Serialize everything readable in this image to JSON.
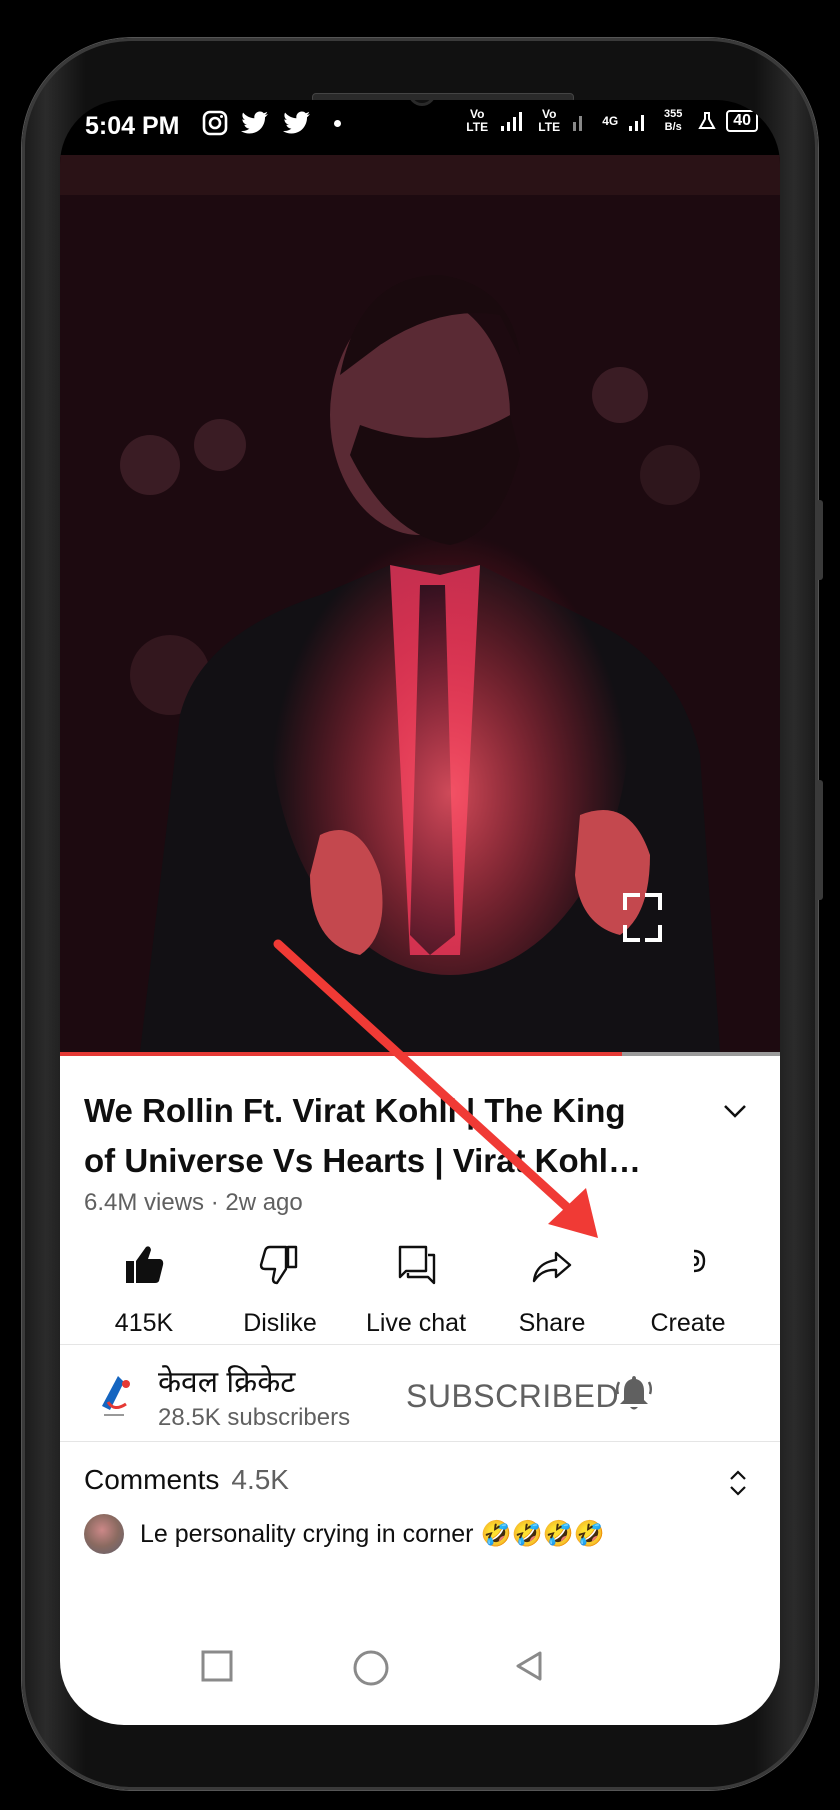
{
  "status_bar": {
    "time": "5:04 PM",
    "network_label_1": "Vo LTE",
    "network_label_2": "Vo LTE",
    "network_4g": "4G",
    "speed": "355 B/s",
    "battery": "40"
  },
  "video": {
    "fullscreen_icon": "fullscreen-icon",
    "progress": 0.78
  },
  "details": {
    "title_line1": "We Rollin Ft. Virat Kohli | The King",
    "title_line2": "of Universe Vs Hearts | Virat Kohli ...",
    "meta": "6.4M views · 2w ago"
  },
  "actions": [
    {
      "label": "415K",
      "icon": "like-icon"
    },
    {
      "label": "Dislike",
      "icon": "dislike-icon"
    },
    {
      "label": "Live chat",
      "icon": "live-chat-icon"
    },
    {
      "label": "Share",
      "icon": "share-icon"
    },
    {
      "label": "Create",
      "icon": "create-icon"
    }
  ],
  "channel": {
    "name": "केवल क्रिकेट",
    "subscribers": "28.5K subscribers",
    "subscribe_label": "SUBSCRIBED"
  },
  "comments": {
    "label": "Comments",
    "count": "4.5K",
    "first_comment": "Le personality crying in corner 🤣🤣🤣🤣"
  },
  "colors": {
    "progress_red": "#e53935",
    "annotation_arrow": "#f03a35"
  }
}
